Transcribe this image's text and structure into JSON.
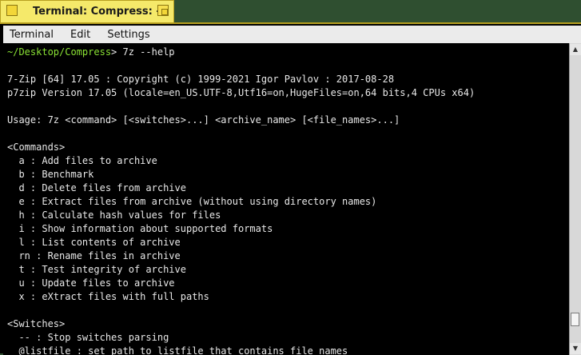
{
  "window": {
    "title": "Terminal: Compress: --"
  },
  "menubar": {
    "items": [
      "Terminal",
      "Edit",
      "Settings"
    ]
  },
  "terminal": {
    "prompt_path": "~/Desktop/Compress",
    "prompt_symbol": ">",
    "command": " 7z --help",
    "lines": [
      "",
      "7-Zip [64] 17.05 : Copyright (c) 1999-2021 Igor Pavlov : 2017-08-28",
      "p7zip Version 17.05 (locale=en_US.UTF-8,Utf16=on,HugeFiles=on,64 bits,4 CPUs x64)",
      "",
      "Usage: 7z <command> [<switches>...] <archive_name> [<file_names>...]",
      "",
      "<Commands>",
      "  a : Add files to archive",
      "  b : Benchmark",
      "  d : Delete files from archive",
      "  e : Extract files from archive (without using directory names)",
      "  h : Calculate hash values for files",
      "  i : Show information about supported formats",
      "  l : List contents of archive",
      "  rn : Rename files in archive",
      "  t : Test integrity of archive",
      "  u : Update files to archive",
      "  x : eXtract files with full paths",
      "",
      "<Switches>",
      "  -- : Stop switches parsing",
      "  @listfile : set path to listfile that contains file names"
    ]
  },
  "scrollbar": {
    "position": 0.9
  }
}
